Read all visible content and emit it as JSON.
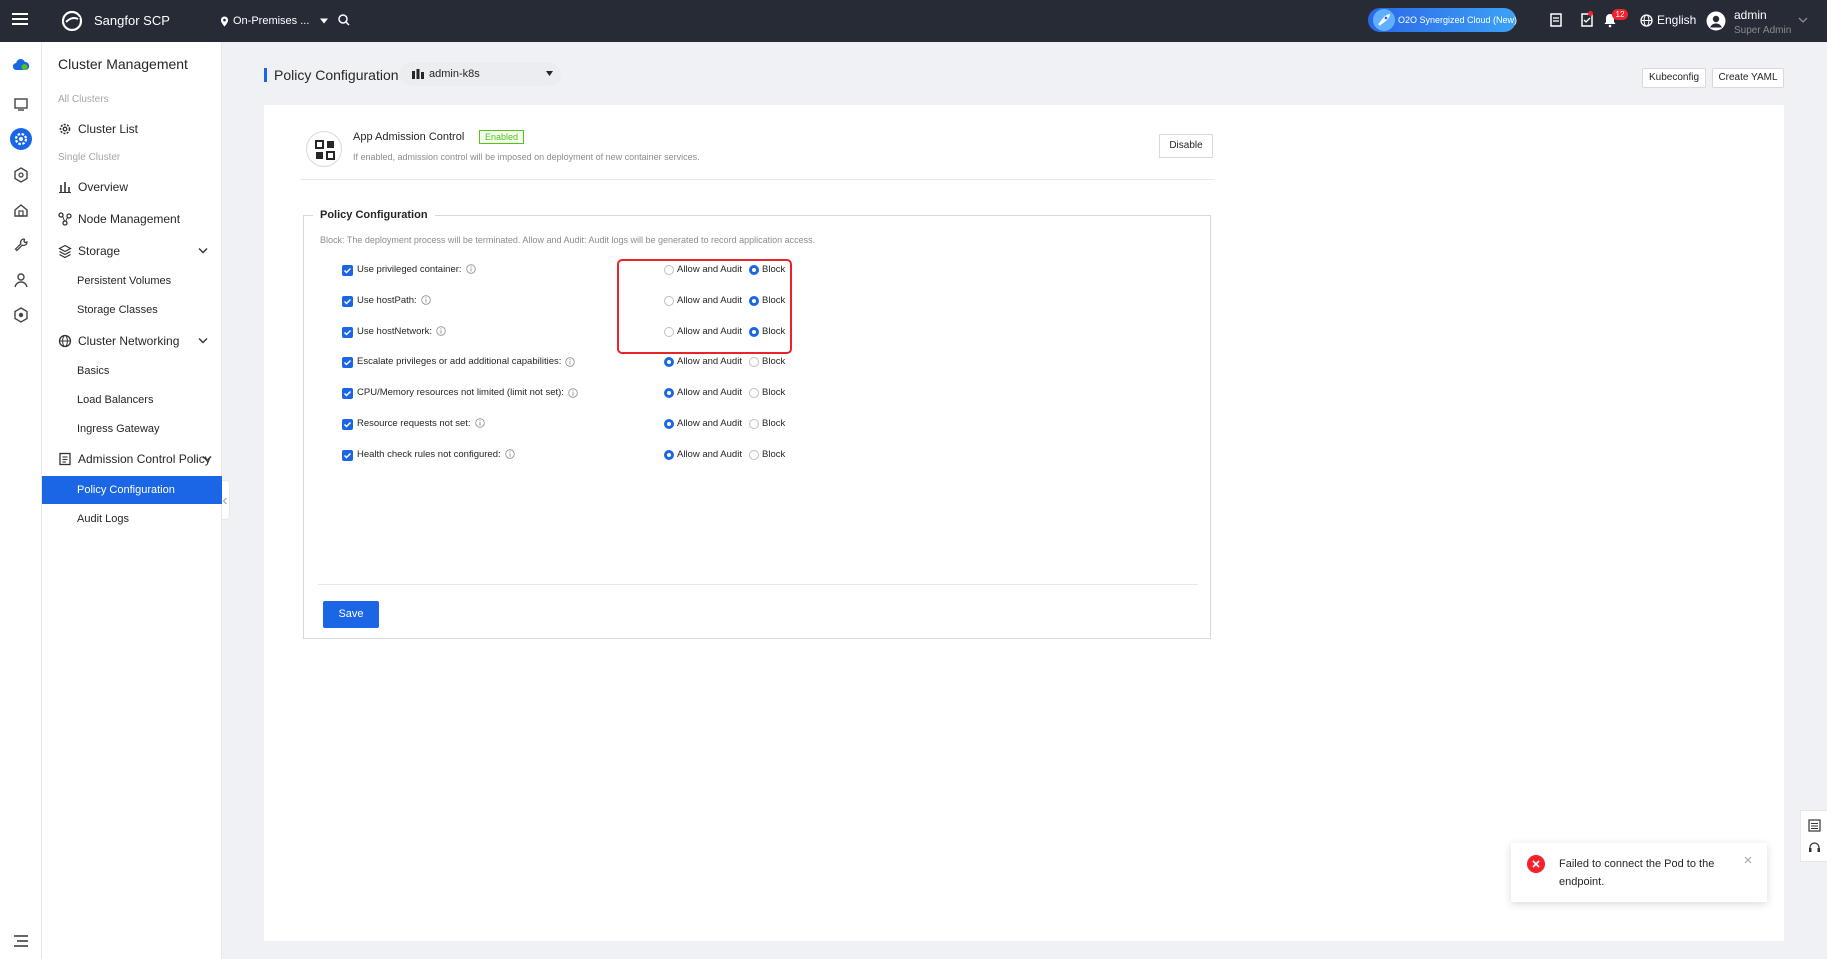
{
  "topbar": {
    "brand": "Sangfor SCP",
    "location": "On-Premises ...",
    "o2o_label": "O2O Synergized Cloud (New)",
    "notification_count": "12",
    "language": "English",
    "user_name": "admin",
    "user_role": "Super Admin"
  },
  "sidebar": {
    "title": "Cluster Management",
    "all_clusters_label": "All Clusters",
    "cluster_list": "Cluster List",
    "single_cluster_label": "Single Cluster",
    "overview": "Overview",
    "node_management": "Node Management",
    "storage": "Storage",
    "persistent_volumes": "Persistent Volumes",
    "storage_classes": "Storage Classes",
    "cluster_networking": "Cluster Networking",
    "basics": "Basics",
    "load_balancers": "Load Balancers",
    "ingress_gateway": "Ingress Gateway",
    "admission_control_policy": "Admission Control Policy",
    "policy_configuration": "Policy Configuration",
    "audit_logs": "Audit Logs"
  },
  "header": {
    "title": "Policy Configuration",
    "cluster": "admin-k8s",
    "kubeconfig": "Kubeconfig",
    "create_yaml": "Create YAML"
  },
  "admission": {
    "title": "App Admission Control",
    "status": "Enabled",
    "description": "If enabled, admission control will be imposed on deployment of new container services.",
    "disable_label": "Disable"
  },
  "policy": {
    "legend": "Policy Configuration",
    "description": "Block: The deployment process will be terminated. Allow and Audit: Audit logs will be generated to record application access.",
    "allow_label": "Allow and Audit",
    "block_label": "Block",
    "rules": [
      {
        "label": "Use privileged container:",
        "checked": true,
        "mode": "Block"
      },
      {
        "label": "Use hostPath:",
        "checked": true,
        "mode": "Block"
      },
      {
        "label": "Use hostNetwork:",
        "checked": true,
        "mode": "Block"
      },
      {
        "label": "Escalate privileges or add additional capabilities:",
        "checked": true,
        "mode": "Allow and Audit"
      },
      {
        "label": "CPU/Memory resources not limited (limit not set):",
        "checked": true,
        "mode": "Allow and Audit"
      },
      {
        "label": "Resource requests not set:",
        "checked": true,
        "mode": "Allow and Audit"
      },
      {
        "label": "Health check rules not configured:",
        "checked": true,
        "mode": "Allow and Audit"
      }
    ],
    "save_label": "Save"
  },
  "toast": {
    "message": "Failed to connect the Pod to the endpoint."
  },
  "colors": {
    "accent": "#1a66e5",
    "topbar": "#272b36",
    "error": "#f5222d",
    "success": "#52c41a",
    "highlight": "#e8262a"
  }
}
